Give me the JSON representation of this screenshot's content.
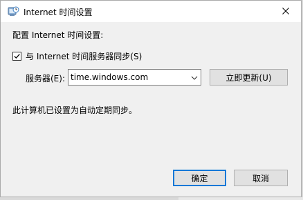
{
  "window": {
    "title": "Internet 时间设置",
    "app_icon": "clock-globe-icon",
    "close_icon": "close-icon"
  },
  "config": {
    "section_label": "配置 Internet 时间设置:",
    "sync_checkbox": {
      "label": "与 Internet 时间服务器同步(S)",
      "checked": true
    },
    "server": {
      "label": "服务器(E):",
      "value": "time.windows.com"
    },
    "update_button": "立即更新(U)",
    "status": "此计算机已设置为自动定期同步。"
  },
  "footer": {
    "ok_button": "确定",
    "cancel_button": "取消"
  },
  "colors": {
    "dialog_bg": "#f0f0f0",
    "titlebar_bg": "#ffffff",
    "button_bg": "#e1e1e1",
    "default_button_border": "#0078d7"
  }
}
